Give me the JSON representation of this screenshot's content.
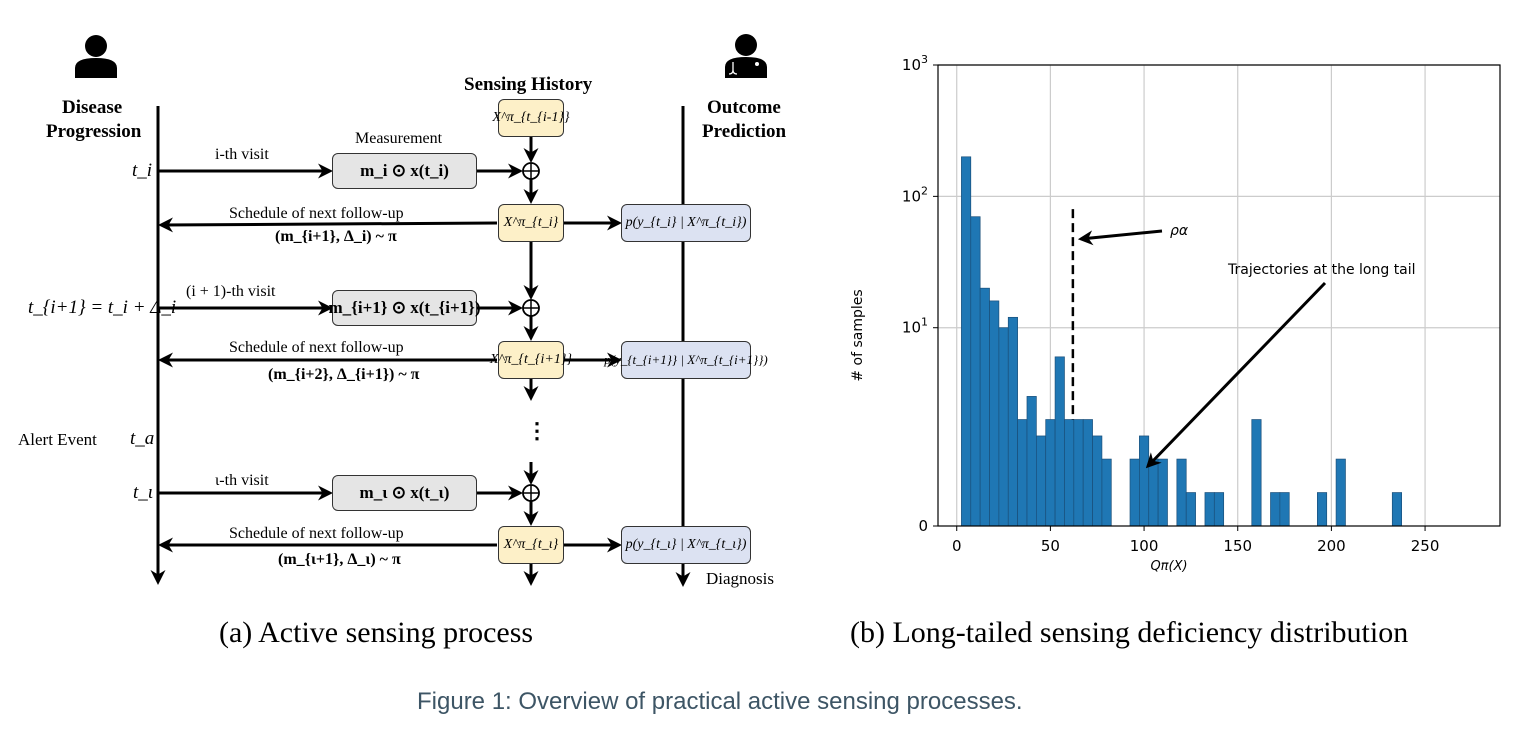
{
  "diagram": {
    "patient_icon": "person-icon",
    "doctor_icon": "doctor-stethoscope-icon",
    "columns": {
      "left_title_1": "Disease",
      "left_title_2": "Progression",
      "middle_title": "Sensing History",
      "right_title_1": "Outcome",
      "right_title_2": "Prediction"
    },
    "measurement_label": "Measurement",
    "time_labels": {
      "t_i": "t_i",
      "t_i1": "t_{i+1} = t_i + Δ_i",
      "alert_event": "Alert Event",
      "t_a": "t_a",
      "t_iota": "t_ι"
    },
    "visits": [
      {
        "label": "i-th visit",
        "measurement": "m_i ⊙ x(t_i)"
      },
      {
        "label": "(i + 1)-th visit",
        "measurement": "m_{i+1} ⊙ x(t_{i+1})"
      },
      {
        "label": "ι-th visit",
        "measurement": "m_ι ⊙ x(t_ι)"
      }
    ],
    "schedules": [
      {
        "label": "Schedule of next follow-up",
        "policy": "(m_{i+1}, Δ_i) ~ π"
      },
      {
        "label": "Schedule of next follow-up",
        "policy": "(m_{i+2}, Δ_{i+1}) ~ π"
      },
      {
        "label": "Schedule of next follow-up",
        "policy": "(m_{ι+1}, Δ_ι) ~ π"
      }
    ],
    "history_boxes": [
      "X^π_{t_{i-1}}",
      "X^π_{t_i}",
      "X^π_{t_{i+1}}",
      "X^π_{t_ι}"
    ],
    "prediction_boxes": [
      "p(y_{t_i} | X^π_{t_i})",
      "p(y_{t_{i+1}} | X^π_{t_{i+1}})",
      "p(y_{t_ι} | X^π_{t_ι})"
    ],
    "ellipsis": "⋮",
    "diagnosis_label": "Diagnosis",
    "subcaption": "(a) Active sensing process"
  },
  "chart_data": {
    "type": "bar",
    "title": "",
    "subcaption": "(b) Long-tailed sensing deficiency distribution",
    "xlabel": "Q^π(X)",
    "ylabel": "# of samples",
    "yscale": "symlog",
    "xlim": [
      -10,
      290
    ],
    "ylim": [
      0,
      1000
    ],
    "x_ticks": [
      0,
      50,
      100,
      150,
      200,
      250
    ],
    "y_ticks": [
      {
        "value": 0,
        "label": "0"
      },
      {
        "value": 10,
        "label": "10^1"
      },
      {
        "value": 100,
        "label": "10^2"
      },
      {
        "value": 1000,
        "label": "10^3"
      }
    ],
    "grid": true,
    "bar_color": "#1f77b4",
    "bin_width": 5,
    "bins": [
      {
        "x0": 2.5,
        "count": 200
      },
      {
        "x0": 7.5,
        "count": 70
      },
      {
        "x0": 12.5,
        "count": 20
      },
      {
        "x0": 17.5,
        "count": 16
      },
      {
        "x0": 22.5,
        "count": 10
      },
      {
        "x0": 27.5,
        "count": 12
      },
      {
        "x0": 32.5,
        "count": 2
      },
      {
        "x0": 37.5,
        "count": 3
      },
      {
        "x0": 42.5,
        "count": 1.5
      },
      {
        "x0": 47.5,
        "count": 2
      },
      {
        "x0": 52.5,
        "count": 6
      },
      {
        "x0": 57.5,
        "count": 2
      },
      {
        "x0": 62.5,
        "count": 2
      },
      {
        "x0": 67.5,
        "count": 2
      },
      {
        "x0": 72.5,
        "count": 1.5
      },
      {
        "x0": 77.5,
        "count": 1
      },
      {
        "x0": 92.5,
        "count": 1
      },
      {
        "x0": 97.5,
        "count": 1.5
      },
      {
        "x0": 102.5,
        "count": 1
      },
      {
        "x0": 107.5,
        "count": 1
      },
      {
        "x0": 117.5,
        "count": 1
      },
      {
        "x0": 122.5,
        "count": 0.5
      },
      {
        "x0": 132.5,
        "count": 0.5
      },
      {
        "x0": 137.5,
        "count": 0.5
      },
      {
        "x0": 157.5,
        "count": 2
      },
      {
        "x0": 167.5,
        "count": 0.5
      },
      {
        "x0": 172.5,
        "count": 0.5
      },
      {
        "x0": 192.5,
        "count": 0.5
      },
      {
        "x0": 202.5,
        "count": 1
      },
      {
        "x0": 232.5,
        "count": 0.5
      }
    ],
    "threshold": {
      "label": "ρ_α",
      "x": 62,
      "top_value": 80,
      "style": "dashed"
    },
    "annotations": [
      {
        "text": "ρ_α",
        "points_to": "threshold line"
      },
      {
        "text": "Trajectories at the long tail",
        "arrow_to_x": 101,
        "arrow_to_value": 0.85
      }
    ]
  },
  "figure_caption": "Figure 1: Overview of practical active sensing processes."
}
